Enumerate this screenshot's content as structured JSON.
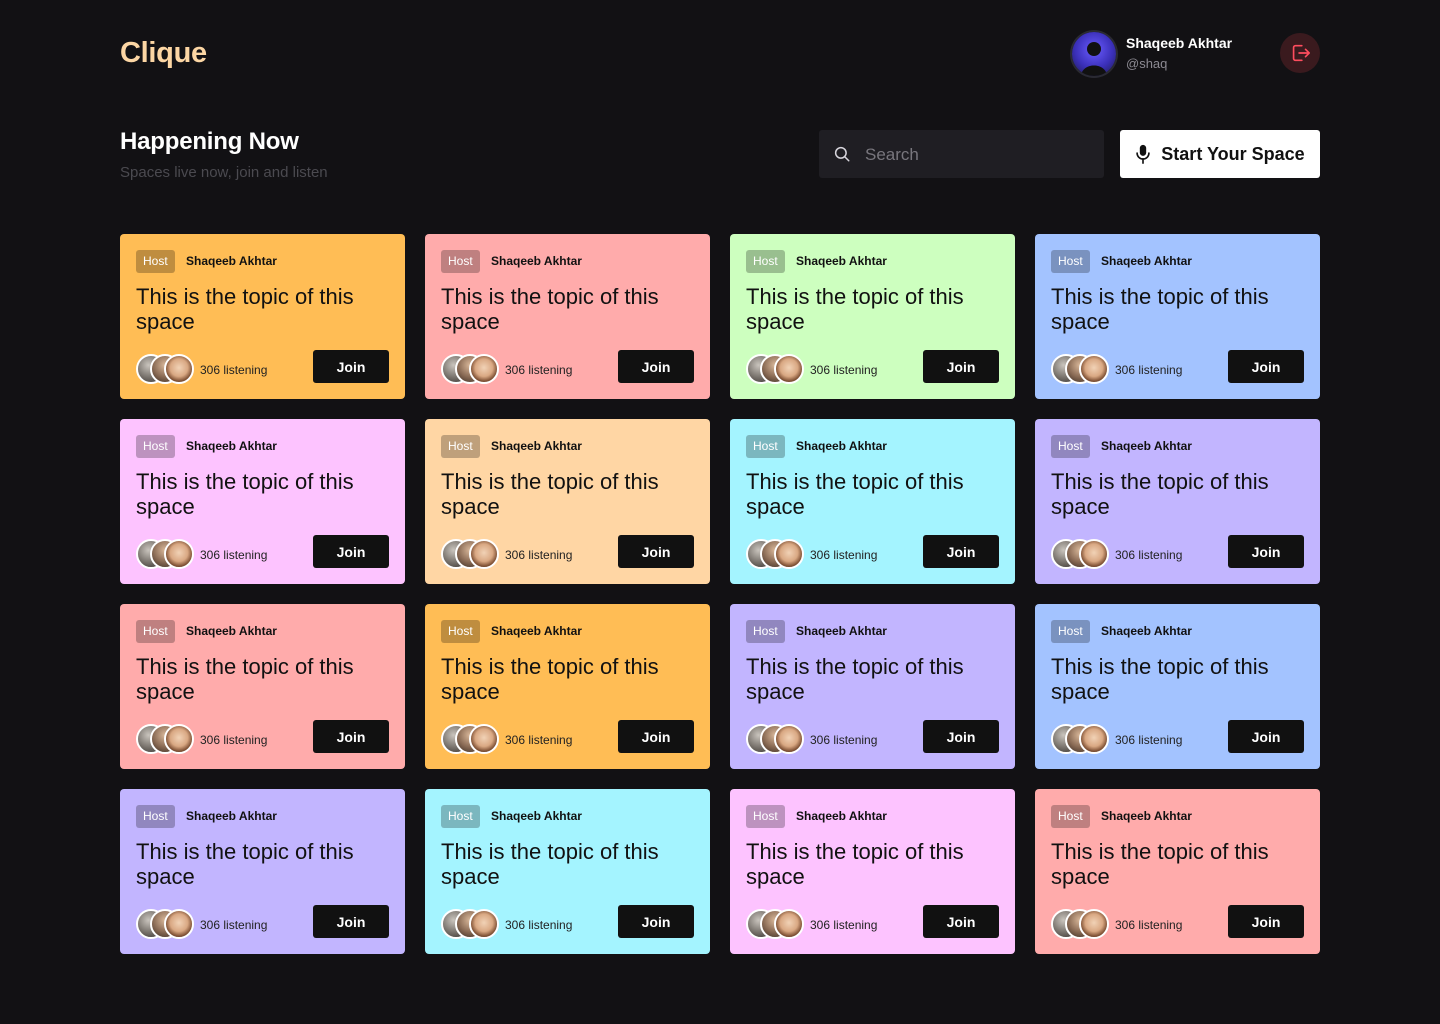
{
  "app": {
    "logo": "Clique"
  },
  "user": {
    "name": "Shaqeeb Akhtar",
    "handle": "@shaq"
  },
  "page": {
    "title": "Happening Now",
    "subtitle": "Spaces live now, join and listen",
    "search_placeholder": "Search",
    "start_button": "Start Your Space"
  },
  "colors": {
    "logo": "#fcd6a4",
    "background": "#121114"
  },
  "spaces": [
    {
      "host_label": "Host",
      "host": "Shaqeeb Akhtar",
      "topic": "This is the topic of this space",
      "listening": "306 listening",
      "join": "Join",
      "color": "#ffbd55"
    },
    {
      "host_label": "Host",
      "host": "Shaqeeb Akhtar",
      "topic": "This is the topic of this space",
      "listening": "306 listening",
      "join": "Join",
      "color": "#ffabab"
    },
    {
      "host_label": "Host",
      "host": "Shaqeeb Akhtar",
      "topic": "This is the topic of this space",
      "listening": "306 listening",
      "join": "Join",
      "color": "#cdffbf"
    },
    {
      "host_label": "Host",
      "host": "Shaqeeb Akhtar",
      "topic": "This is the topic of this space",
      "listening": "306 listening",
      "join": "Join",
      "color": "#a3c3ff"
    },
    {
      "host_label": "Host",
      "host": "Shaqeeb Akhtar",
      "topic": "This is the topic of this space",
      "listening": "306 listening",
      "join": "Join",
      "color": "#fdc3ff"
    },
    {
      "host_label": "Host",
      "host": "Shaqeeb Akhtar",
      "topic": "This is the topic of this space",
      "listening": "306 listening",
      "join": "Join",
      "color": "#ffd6a4"
    },
    {
      "host_label": "Host",
      "host": "Shaqeeb Akhtar",
      "topic": "This is the topic of this space",
      "listening": "306 listening",
      "join": "Join",
      "color": "#a4f4ff"
    },
    {
      "host_label": "Host",
      "host": "Shaqeeb Akhtar",
      "topic": "This is the topic of this space",
      "listening": "306 listening",
      "join": "Join",
      "color": "#c2b5ff"
    },
    {
      "host_label": "Host",
      "host": "Shaqeeb Akhtar",
      "topic": "This is the topic of this space",
      "listening": "306 listening",
      "join": "Join",
      "color": "#ffabab"
    },
    {
      "host_label": "Host",
      "host": "Shaqeeb Akhtar",
      "topic": "This is the topic of this space",
      "listening": "306 listening",
      "join": "Join",
      "color": "#ffbd55"
    },
    {
      "host_label": "Host",
      "host": "Shaqeeb Akhtar",
      "topic": "This is the topic of this space",
      "listening": "306 listening",
      "join": "Join",
      "color": "#c2b5ff"
    },
    {
      "host_label": "Host",
      "host": "Shaqeeb Akhtar",
      "topic": "This is the topic of this space",
      "listening": "306 listening",
      "join": "Join",
      "color": "#a3c3ff"
    },
    {
      "host_label": "Host",
      "host": "Shaqeeb Akhtar",
      "topic": "This is the topic of this space",
      "listening": "306 listening",
      "join": "Join",
      "color": "#c2b5ff"
    },
    {
      "host_label": "Host",
      "host": "Shaqeeb Akhtar",
      "topic": "This is the topic of this space",
      "listening": "306 listening",
      "join": "Join",
      "color": "#a4f4ff"
    },
    {
      "host_label": "Host",
      "host": "Shaqeeb Akhtar",
      "topic": "This is the topic of this space",
      "listening": "306 listening",
      "join": "Join",
      "color": "#fdc3ff"
    },
    {
      "host_label": "Host",
      "host": "Shaqeeb Akhtar",
      "topic": "This is the topic of this space",
      "listening": "306 listening",
      "join": "Join",
      "color": "#ffabab"
    }
  ]
}
